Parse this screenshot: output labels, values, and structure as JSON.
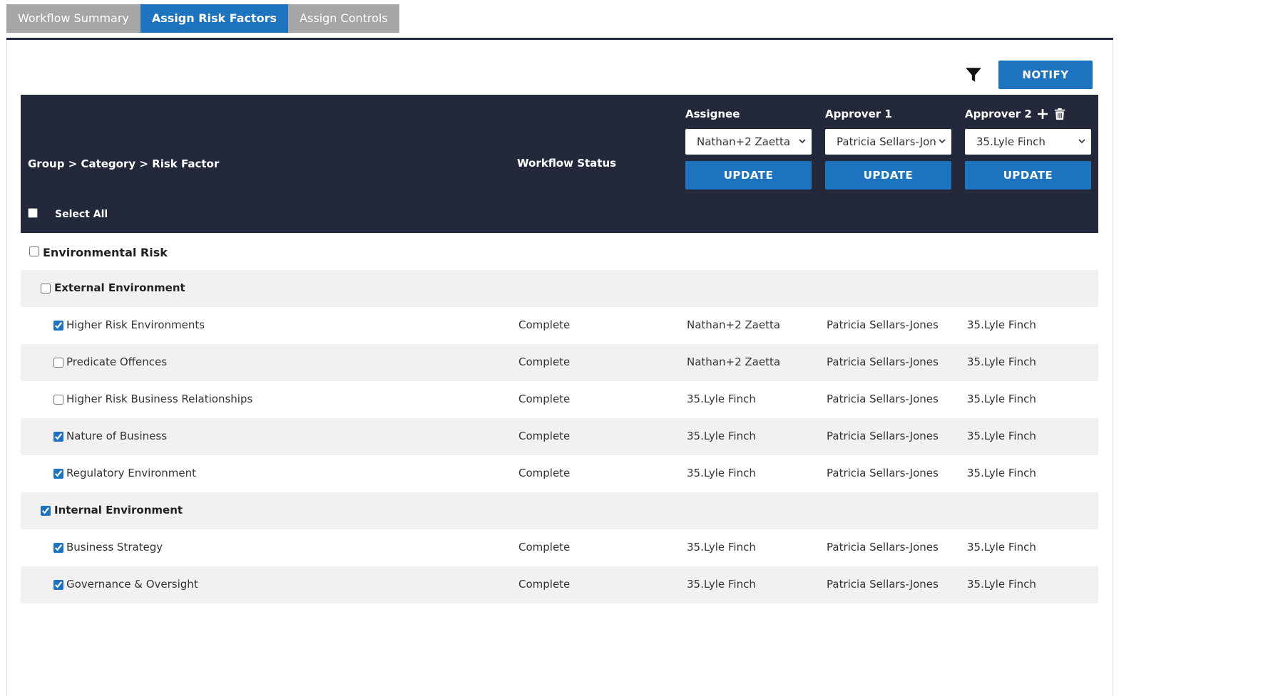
{
  "tabs": [
    {
      "label": "Workflow Summary",
      "active": false
    },
    {
      "label": "Assign Risk Factors",
      "active": true
    },
    {
      "label": "Assign Controls",
      "active": false
    }
  ],
  "toolbar": {
    "notify_label": "NOTIFY",
    "filter_icon": "filter-icon"
  },
  "header": {
    "group_col": "Group > Category > Risk Factor",
    "status_col": "Workflow Status",
    "select_all": "Select All",
    "assignee": {
      "title": "Assignee",
      "selected": "Nathan+2 Zaetta",
      "update": "UPDATE"
    },
    "approver1": {
      "title": "Approver 1",
      "selected": "Patricia Sellars-Jon",
      "update": "UPDATE"
    },
    "approver2": {
      "title": "Approver 2",
      "selected": "35.Lyle Finch",
      "update": "UPDATE"
    }
  },
  "rows": [
    {
      "type": "group",
      "label": "Environmental Risk",
      "checked": false
    },
    {
      "type": "category",
      "label": "External Environment",
      "checked": false
    },
    {
      "type": "factor",
      "label": "Higher Risk Environments",
      "checked": true,
      "status": "Complete",
      "assignee": "Nathan+2 Zaetta",
      "approver1": "Patricia Sellars-Jones",
      "approver2": "35.Lyle Finch"
    },
    {
      "type": "factor",
      "label": "Predicate Offences",
      "checked": false,
      "status": "Complete",
      "assignee": "Nathan+2 Zaetta",
      "approver1": "Patricia Sellars-Jones",
      "approver2": "35.Lyle Finch"
    },
    {
      "type": "factor",
      "label": "Higher Risk Business Relationships",
      "checked": false,
      "status": "Complete",
      "assignee": "35.Lyle Finch",
      "approver1": "Patricia Sellars-Jones",
      "approver2": "35.Lyle Finch"
    },
    {
      "type": "factor",
      "label": "Nature of Business",
      "checked": true,
      "status": "Complete",
      "assignee": "35.Lyle Finch",
      "approver1": "Patricia Sellars-Jones",
      "approver2": "35.Lyle Finch"
    },
    {
      "type": "factor",
      "label": "Regulatory Environment",
      "checked": true,
      "status": "Complete",
      "assignee": "35.Lyle Finch",
      "approver1": "Patricia Sellars-Jones",
      "approver2": "35.Lyle Finch"
    },
    {
      "type": "category",
      "label": "Internal Environment",
      "checked": true
    },
    {
      "type": "factor",
      "label": "Business Strategy",
      "checked": true,
      "status": "Complete",
      "assignee": "35.Lyle Finch",
      "approver1": "Patricia Sellars-Jones",
      "approver2": "35.Lyle Finch"
    },
    {
      "type": "factor",
      "label": "Governance & Oversight",
      "checked": true,
      "status": "Complete",
      "assignee": "35.Lyle Finch",
      "approver1": "Patricia Sellars-Jones",
      "approver2": "35.Lyle Finch"
    }
  ],
  "colors": {
    "accent": "#1e73be",
    "header_bg": "#23283b",
    "tab_inactive": "#a6a6a6",
    "row_shade": "#f1f1f1"
  }
}
